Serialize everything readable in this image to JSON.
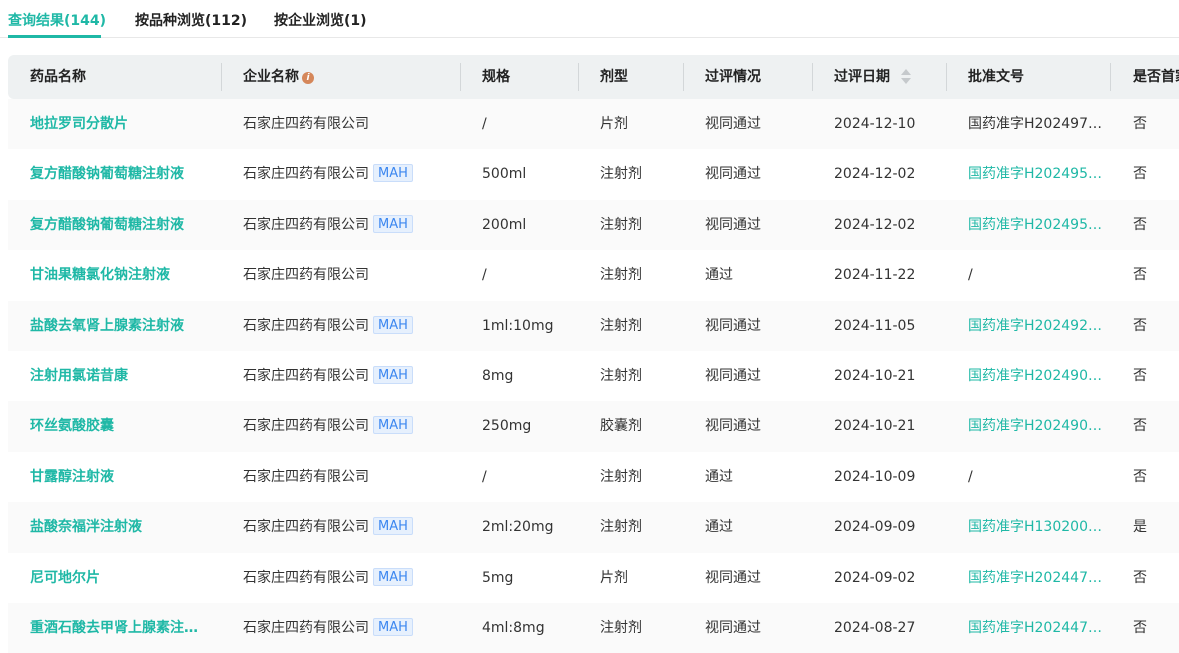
{
  "tabs": [
    {
      "label": "查询结果(144)"
    },
    {
      "label": "按品种浏览(112)"
    },
    {
      "label": "按企业浏览(1)"
    }
  ],
  "columns": [
    "药品名称",
    "企业名称",
    "规格",
    "剂型",
    "过评情况",
    "过评日期",
    "批准文号",
    "是否首家"
  ],
  "badge": "MAH",
  "rows": [
    {
      "name": "地拉罗司分散片",
      "company": "石家庄四药有限公司",
      "mah": false,
      "spec": "/",
      "form": "片剂",
      "status": "视同通过",
      "date": "2024-12-10",
      "approval": "国药准字H202497…",
      "approval_link": false,
      "first": "否"
    },
    {
      "name": "复方醋酸钠葡萄糖注射液",
      "company": "石家庄四药有限公司",
      "mah": true,
      "spec": "500ml",
      "form": "注射剂",
      "status": "视同通过",
      "date": "2024-12-02",
      "approval": "国药准字H202495…",
      "approval_link": true,
      "first": "否"
    },
    {
      "name": "复方醋酸钠葡萄糖注射液",
      "company": "石家庄四药有限公司",
      "mah": true,
      "spec": "200ml",
      "form": "注射剂",
      "status": "视同通过",
      "date": "2024-12-02",
      "approval": "国药准字H202495…",
      "approval_link": true,
      "first": "否"
    },
    {
      "name": "甘油果糖氯化钠注射液",
      "company": "石家庄四药有限公司",
      "mah": false,
      "spec": "/",
      "form": "注射剂",
      "status": "通过",
      "date": "2024-11-22",
      "approval": "/",
      "approval_link": false,
      "first": "否"
    },
    {
      "name": "盐酸去氧肾上腺素注射液",
      "company": "石家庄四药有限公司",
      "mah": true,
      "spec": "1ml:10mg",
      "form": "注射剂",
      "status": "视同通过",
      "date": "2024-11-05",
      "approval": "国药准字H202492…",
      "approval_link": true,
      "first": "否"
    },
    {
      "name": "注射用氯诺昔康",
      "company": "石家庄四药有限公司",
      "mah": true,
      "spec": "8mg",
      "form": "注射剂",
      "status": "视同通过",
      "date": "2024-10-21",
      "approval": "国药准字H202490…",
      "approval_link": true,
      "first": "否"
    },
    {
      "name": "环丝氨酸胶囊",
      "company": "石家庄四药有限公司",
      "mah": true,
      "spec": "250mg",
      "form": "胶囊剂",
      "status": "视同通过",
      "date": "2024-10-21",
      "approval": "国药准字H202490…",
      "approval_link": true,
      "first": "否"
    },
    {
      "name": "甘露醇注射液",
      "company": "石家庄四药有限公司",
      "mah": false,
      "spec": "/",
      "form": "注射剂",
      "status": "通过",
      "date": "2024-10-09",
      "approval": "/",
      "approval_link": false,
      "first": "否"
    },
    {
      "name": "盐酸奈福泮注射液",
      "company": "石家庄四药有限公司",
      "mah": true,
      "spec": "2ml:20mg",
      "form": "注射剂",
      "status": "通过",
      "date": "2024-09-09",
      "approval": "国药准字H130200…",
      "approval_link": true,
      "first": "是"
    },
    {
      "name": "尼可地尔片",
      "company": "石家庄四药有限公司",
      "mah": true,
      "spec": "5mg",
      "form": "片剂",
      "status": "视同通过",
      "date": "2024-09-02",
      "approval": "国药准字H202447…",
      "approval_link": true,
      "first": "否"
    },
    {
      "name": "重酒石酸去甲肾上腺素注…",
      "company": "石家庄四药有限公司",
      "mah": true,
      "spec": "4ml:8mg",
      "form": "注射剂",
      "status": "视同通过",
      "date": "2024-08-27",
      "approval": "国药准字H202447…",
      "approval_link": true,
      "first": "否"
    }
  ]
}
